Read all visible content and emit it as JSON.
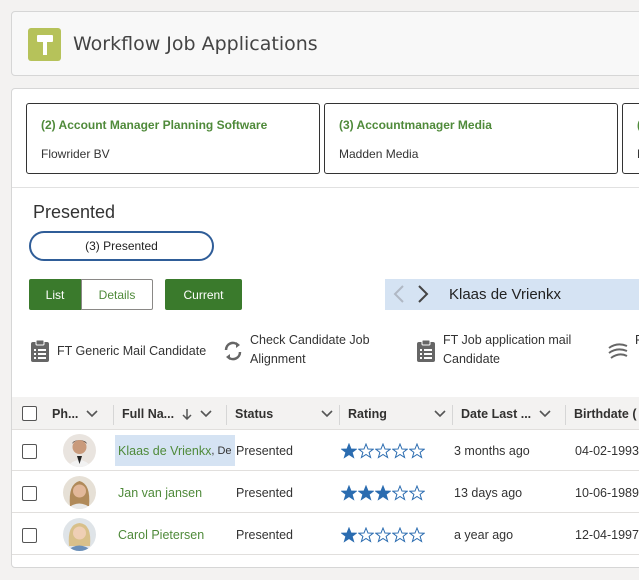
{
  "app": {
    "title": "Workflow Job Applications",
    "icon": "hammer-icon",
    "accent": "#b6c25a"
  },
  "vacancies": [
    {
      "title": "(2) Account Manager Planning Software",
      "company": "Flowrider BV"
    },
    {
      "title": "(3) Accountmanager Media",
      "company": "Madden Media"
    },
    {
      "title": "(",
      "company": "M"
    }
  ],
  "stage": {
    "heading": "Presented",
    "pill": "(3) Presented"
  },
  "view": {
    "list": "List",
    "details": "Details",
    "current": "Current"
  },
  "navigator": {
    "name": "Klaas de Vrienkx"
  },
  "actions": [
    {
      "label": "FT Generic Mail Candidate",
      "icon": "clipboard-icon"
    },
    {
      "label": "Check Candidate Job Alignment",
      "icon": "sync-icon"
    },
    {
      "label": "FT Job application mail Candidate",
      "icon": "clipboard-icon"
    },
    {
      "label": "F c",
      "icon": "flow-icon"
    }
  ],
  "grid": {
    "columns": {
      "photo": "Ph...",
      "fullname": "Full Na...",
      "status": "Status",
      "rating": "Rating",
      "date_last": "Date Last ...",
      "birthdate": "Birthdate ("
    },
    "rows": [
      {
        "name": "Klaas de Vrienkx",
        "name_suffix": ", De",
        "status": "Presented",
        "rating": 1,
        "date_last": "3 months ago",
        "birthdate": "04-02-1993"
      },
      {
        "name": "Jan van jansen",
        "name_suffix": "",
        "status": "Presented",
        "rating": 3,
        "date_last": "13 days ago",
        "birthdate": "10-06-1989"
      },
      {
        "name": "Carol Pietersen",
        "name_suffix": "",
        "status": "Presented",
        "rating": 1,
        "date_last": "a year ago",
        "birthdate": "12-04-1997"
      }
    ]
  },
  "colors": {
    "primary_green": "#3a7a2c",
    "link_green": "#4f8a3a",
    "star_blue": "#2b6cb0",
    "selection": "#d5e3f3"
  }
}
